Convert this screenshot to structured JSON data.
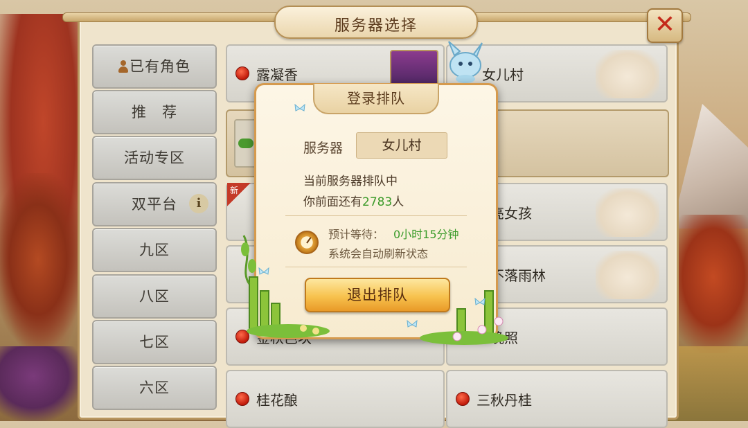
{
  "title": "服务器选择",
  "close_symbol": "✕",
  "sidebar": {
    "items": [
      {
        "label": "已有角色",
        "icon": "person-icon"
      },
      {
        "label": "推　荐"
      },
      {
        "label": "活动专区"
      },
      {
        "label": "双平台",
        "icon": "info-icon",
        "icon_text": "i"
      },
      {
        "label": "九区"
      },
      {
        "label": "八区"
      },
      {
        "label": "七区"
      },
      {
        "label": "六区"
      }
    ]
  },
  "servers": [
    {
      "name": "露凝香"
    },
    {
      "name": "女儿村"
    },
    {
      "name": "亮女孩"
    },
    {
      "name": "不落雨林"
    },
    {
      "name": "金秋芭块"
    },
    {
      "name": "晚照"
    },
    {
      "name": "桂花酿"
    },
    {
      "name": "三秋丹桂"
    }
  ],
  "new_badge": "新",
  "dialog": {
    "title": "登录排队",
    "server_label": "服务器",
    "server_value": "女儿村",
    "status": "当前服务器排队中",
    "ahead_prefix": "你前面还有",
    "ahead_count": "2783",
    "ahead_suffix": "人",
    "wait_label": "预计等待：",
    "wait_value": "0小时15分钟",
    "auto_refresh": "系统会自动刷新状态",
    "exit_button": "退出排队"
  },
  "colors": {
    "accent_green": "#3c9b2a",
    "button_gold": "#f7c24e",
    "close_red": "#c42a1a",
    "status_dot": "#c01a0a"
  }
}
